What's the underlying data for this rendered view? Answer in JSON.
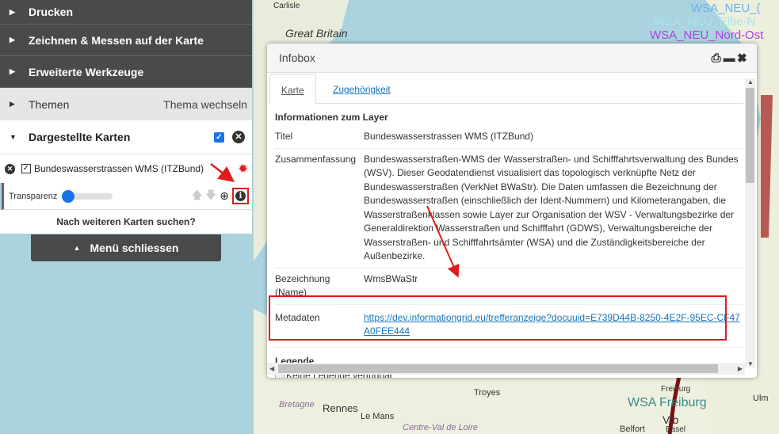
{
  "menu": {
    "items": [
      {
        "label": "Drucken"
      },
      {
        "label": "Zeichnen & Messen auf der Karte"
      },
      {
        "label": "Erweiterte Werkzeuge"
      }
    ],
    "themen": {
      "label": "Themen",
      "action": "Thema wechseln"
    },
    "shown_maps": {
      "label": "Dargestellte Karten",
      "checked": true
    },
    "layer": {
      "name": "Bundeswasserstrassen WMS (ITZBund)",
      "checked": true,
      "transparency_label": "Transparenz",
      "transparency": 0
    },
    "search_more": "Nach weiteren Karten suchen?",
    "close_menu": "Menü schliessen"
  },
  "infobox": {
    "title": "Infobox",
    "tabs": [
      {
        "label": "Karte",
        "active": true
      },
      {
        "label": "Zugehörigkeit"
      }
    ],
    "section": "Informationen zum Layer",
    "rows": [
      {
        "key": "Titel",
        "value": "Bundeswasserstrassen WMS (ITZBund)"
      },
      {
        "key": "Zusammenfassung",
        "value": "Bundeswasserstraßen-WMS der Wasserstraßen- und Schifffahrtsverwaltung des Bundes (WSV). Dieser Geodatendienst visualisiert das topologisch verknüpfte Netz der Bundeswasserstraßen (VerkNet BWaStr). Die Daten umfassen die Bezeichnung der Bundeswasserstraßen (einschließlich der Ident-Nummern) und Kilometerangaben, die Wasserstraßenklassen sowie Layer zur Organisation der WSV - Verwaltungsbezirke der Generaldirektion Wasserstraßen und Schifffahrt (GDWS), Verwaltungsbereiche der Wasserstraßen- und Schifffahrtsämter (WSA) und die Zuständigkeitsbereiche der Außenbezirke."
      },
      {
        "key": "Bezeichnung (Name)",
        "value": "WmsBWaStr"
      },
      {
        "key": "Metadaten",
        "value": "https://dev.informationgrid.eu/trefferanzeige?docuuid=E739D44B-8250-4E2F-95EC-CF47A0FEE444"
      }
    ],
    "legend_title": "Legende",
    "legend_text": "Keine Legende verfügbar"
  },
  "map": {
    "labels": [
      "Great Britain",
      "Carlisle",
      "WSA_NEU_(",
      "WSA_NEU_Elbe-N",
      "WSA_NEU_Nord-Ost",
      "Bretagne",
      "Rennes",
      "Le Mans",
      "Centre-Val de Loire",
      "Troyes",
      "WSA Freiburg",
      "Vlb",
      "Belfort",
      "Basel",
      "Ulm",
      "Freiburg"
    ]
  },
  "colors": {
    "dark": "#4a4a4a",
    "link": "#1a73b8",
    "highlight": "#e01b1b",
    "sea": "#aad3df",
    "land": "#f0efe4"
  }
}
